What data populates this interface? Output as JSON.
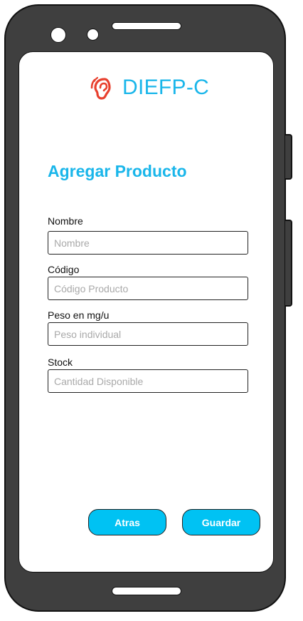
{
  "app": {
    "brand_name": "DIEFP-C",
    "logo_icon": "ear-icon",
    "accent_color": "#1ab6ea",
    "logo_color": "#e8402e"
  },
  "page": {
    "title": "Agregar Producto"
  },
  "form": {
    "fields": [
      {
        "label": "Nombre",
        "placeholder": "Nombre",
        "value": ""
      },
      {
        "label": "Código",
        "placeholder": "Código Producto",
        "value": ""
      },
      {
        "label": "Peso en mg/u",
        "placeholder": "Peso individual",
        "value": ""
      },
      {
        "label": "Stock",
        "placeholder": "Cantidad Disponible",
        "value": ""
      }
    ]
  },
  "actions": {
    "back_label": "Atras",
    "save_label": "Guardar",
    "button_color": "#00c2f3"
  }
}
